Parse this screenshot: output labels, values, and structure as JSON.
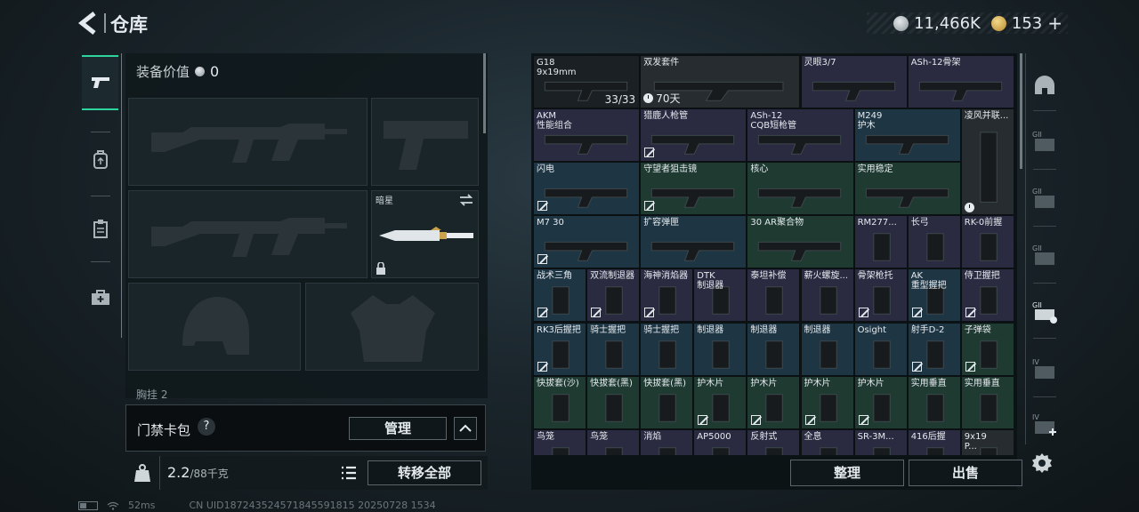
{
  "header": {
    "title": "仓库",
    "silver_amount": "11,466K",
    "gold_amount": "153",
    "gold_plus": "+"
  },
  "left_rail": {
    "items": [
      {
        "icon": "pistol-icon",
        "active": true
      },
      {
        "icon": "backpack-icon",
        "active": false
      },
      {
        "icon": "clipboard-icon",
        "active": false
      },
      {
        "icon": "medkit-icon",
        "active": false
      }
    ]
  },
  "equipment": {
    "value_label": "装备价值",
    "value": "0",
    "secondary_slot_label": "暗星",
    "chest_label": "胸挂 2"
  },
  "keycard": {
    "label": "门禁卡包",
    "help": "?",
    "manage_label": "管理"
  },
  "storage": {
    "weight": "2.2",
    "weight_max": "/88千克",
    "transfer_all_label": "转移全部"
  },
  "status": {
    "ping": "52ms",
    "uid": "CN UID187243524571845591815 20250728 1534"
  },
  "inventory": {
    "items": [
      {
        "name": "G18\n9x19mm",
        "qty": "33/33",
        "color": "#1a2023"
      },
      {
        "name": "双发套件",
        "time": "70天",
        "color": "#262c2f"
      },
      {
        "name": "灵眼3/7",
        "color": "#2a2a40"
      },
      {
        "name": "ASh-12骨架",
        "color": "#2a2a40"
      },
      {
        "name": "AKM\n性能组合",
        "color": "#2a2a40"
      },
      {
        "name": "猎鹿人枪管",
        "color": "#2a2a40"
      },
      {
        "name": "ASh-12\nCQB短枪管",
        "color": "#2a2a40"
      },
      {
        "name": "M249\n护木",
        "color": "#1e3544"
      },
      {
        "name": "凌风并联...",
        "color": "#262c2f"
      },
      {
        "name": "闪电",
        "color": "#1e3544"
      },
      {
        "name": "守望者狙击镜",
        "color": "#1e3a31"
      },
      {
        "name": "核心",
        "color": "#1e3a31"
      },
      {
        "name": "实用稳定",
        "color": "#1e3a31"
      },
      {
        "name": "M7 30",
        "color": "#1e3544"
      },
      {
        "name": "扩容弹匣",
        "color": "#1e3544"
      },
      {
        "name": "30 AR聚合物",
        "color": "#1e3a31"
      },
      {
        "name": "RM277...",
        "color": "#2a2a40"
      },
      {
        "name": "长弓",
        "color": "#2a2a40"
      },
      {
        "name": "RK-0前握",
        "color": "#2a2a40"
      },
      {
        "name": "战术三角",
        "color": "#1e3544"
      },
      {
        "name": "双流制退器",
        "color": "#2a2a40"
      },
      {
        "name": "海神消焰器",
        "color": "#2a2a40"
      },
      {
        "name": "DTK\n制退器",
        "color": "#2a2a40"
      },
      {
        "name": "泰坦补偿",
        "color": "#2a2a40"
      },
      {
        "name": "薪火螺旋...",
        "color": "#2a2a40"
      },
      {
        "name": "骨架枪托",
        "color": "#2a2a40"
      },
      {
        "name": "AK\n重型握把",
        "color": "#1e3544"
      },
      {
        "name": "侍卫握把",
        "color": "#2a2a40"
      },
      {
        "name": "RK3后握把",
        "color": "#1e3544"
      },
      {
        "name": "骑士握把",
        "color": "#1e3544"
      },
      {
        "name": "骑士握把",
        "color": "#1e3544"
      },
      {
        "name": "制退器",
        "color": "#1e3544"
      },
      {
        "name": "制退器",
        "color": "#1e3544"
      },
      {
        "name": "制退器",
        "color": "#1e3544"
      },
      {
        "name": "Osight",
        "color": "#1e3544"
      },
      {
        "name": "射手D-2",
        "color": "#1e3544"
      },
      {
        "name": "子弹袋",
        "color": "#1e3a31"
      },
      {
        "name": "快拔套(沙)",
        "color": "#1e3a31"
      },
      {
        "name": "快拔套(黑)",
        "color": "#1e3a31"
      },
      {
        "name": "快拔套(黑)",
        "color": "#1e3a31"
      },
      {
        "name": "护木片",
        "color": "#1e3a31"
      },
      {
        "name": "护木片",
        "color": "#1e3a31"
      },
      {
        "name": "护木片",
        "color": "#1e3a31"
      },
      {
        "name": "护木片",
        "color": "#1e3a31"
      },
      {
        "name": "实用垂直",
        "color": "#1e3a31"
      },
      {
        "name": "实用垂直",
        "color": "#1e3a31"
      },
      {
        "name": "鸟笼",
        "color": "#2a2a40"
      },
      {
        "name": "鸟笼",
        "color": "#2a2a40"
      },
      {
        "name": "消焰",
        "color": "#2a2a40"
      },
      {
        "name": "AP5000",
        "color": "#2a2a40"
      },
      {
        "name": "反射式",
        "color": "#2a2a40"
      },
      {
        "name": "全息",
        "color": "#2a2a40"
      },
      {
        "name": "SR-3M...",
        "color": "#2a2a40"
      },
      {
        "name": "416后握",
        "color": "#2a2a40"
      },
      {
        "name": "9x19\nP...",
        "color": "#262c2f"
      }
    ],
    "sort_label": "整理",
    "sell_label": "出售"
  },
  "right_rail": {
    "items": [
      {
        "icon": "helmet-icon"
      },
      {
        "icon": "armor-tier-2-icon",
        "label": "GII"
      },
      {
        "icon": "armor-tier-2-icon",
        "label": "GII"
      },
      {
        "icon": "armor-tier-2-icon",
        "label": "GII"
      },
      {
        "icon": "armor-tier-2-active-icon",
        "label": "GII"
      },
      {
        "icon": "armor-tier-4-icon",
        "label": "IV"
      },
      {
        "icon": "armor-tier-4-add-icon",
        "label": "IV"
      }
    ]
  }
}
